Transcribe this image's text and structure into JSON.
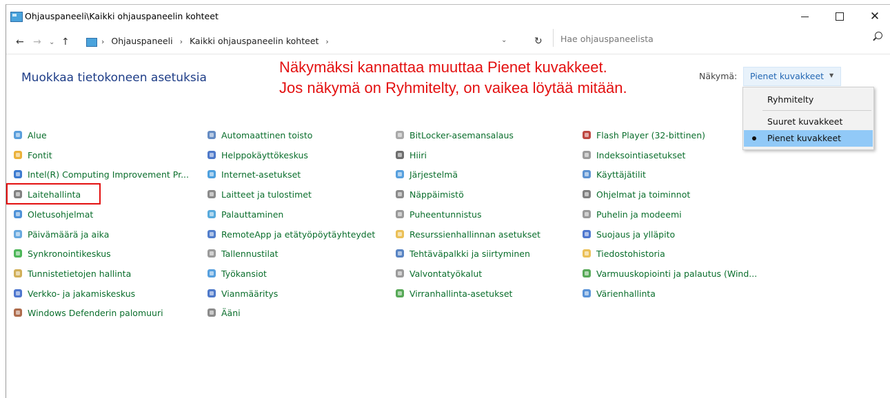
{
  "window": {
    "title": "Ohjauspaneeli\\Kaikki ohjauspaneelin kohteet",
    "minimize_icon": "minimize-icon",
    "maximize_icon": "maximize-icon",
    "close_glyph": "✕"
  },
  "address": {
    "crumbs": [
      "Ohjauspaneeli",
      "Kaikki ohjauspaneelin kohteet"
    ],
    "search_placeholder": "Hae ohjauspaneelista"
  },
  "header": {
    "title": "Muokkaa tietokoneen asetuksia",
    "annotation_line1": "Näkymäksi kannattaa muuttaa Pienet kuvakkeet.",
    "annotation_line2": "Jos näkymä on Ryhmitelty, on vaikea löytää mitään.",
    "view_label": "Näkymä:",
    "view_value": "Pienet kuvakkeet"
  },
  "view_menu": {
    "options": [
      "Ryhmitelty",
      "Suuret kuvakkeet",
      "Pienet kuvakkeet"
    ],
    "selected": "Pienet kuvakkeet"
  },
  "colors": {
    "link": "#0a6e2c",
    "title": "#1e3d87",
    "annotation": "#e31010",
    "menu_selected": "#91c9f7"
  },
  "columns": [
    [
      {
        "label": "Alue",
        "icon": "globe-clock-icon",
        "color": "#3c8dd6"
      },
      {
        "label": "Fontit",
        "icon": "font-icon",
        "color": "#e8a317"
      },
      {
        "label": "Intel(R) Computing Improvement Pr...",
        "icon": "intel-icon",
        "color": "#1a64c8"
      },
      {
        "label": "Laitehallinta",
        "icon": "device-manager-icon",
        "color": "#6b6b6b"
      },
      {
        "label": "Oletusohjelmat",
        "icon": "default-programs-icon",
        "color": "#2f7fd1"
      },
      {
        "label": "Päivämäärä ja aika",
        "icon": "calendar-clock-icon",
        "color": "#4d9ad9"
      },
      {
        "label": "Synkronointikeskus",
        "icon": "sync-icon",
        "color": "#2eaa3c"
      },
      {
        "label": "Tunnistetietojen hallinta",
        "icon": "credential-vault-icon",
        "color": "#c9a13b"
      },
      {
        "label": "Verkko- ja jakamiskeskus",
        "icon": "network-icon",
        "color": "#2f5fc7"
      },
      {
        "label": "Windows Defenderin palomuuri",
        "icon": "firewall-icon",
        "color": "#a0522d"
      }
    ],
    [
      {
        "label": "Automaattinen toisto",
        "icon": "autoplay-icon",
        "color": "#4a78b8"
      },
      {
        "label": "Helppokäyttökeskus",
        "icon": "ease-of-access-icon",
        "color": "#2f62c0"
      },
      {
        "label": "Internet-asetukset",
        "icon": "internet-options-icon",
        "color": "#2f8fd8"
      },
      {
        "label": "Laitteet ja tulostimet",
        "icon": "printer-icon",
        "color": "#777777"
      },
      {
        "label": "Palauttaminen",
        "icon": "recovery-icon",
        "color": "#3b9bd6"
      },
      {
        "label": "RemoteApp ja etätyöpöytäyhteydet",
        "icon": "remote-desktop-icon",
        "color": "#3467c2"
      },
      {
        "label": "Tallennustilat",
        "icon": "storage-spaces-icon",
        "color": "#8a8a8a"
      },
      {
        "label": "Työkansiot",
        "icon": "work-folders-icon",
        "color": "#3a8fd8"
      },
      {
        "label": "Vianmääritys",
        "icon": "troubleshooting-icon",
        "color": "#2f62c0"
      },
      {
        "label": "Ääni",
        "icon": "speaker-icon",
        "color": "#777777"
      }
    ],
    [
      {
        "label": "BitLocker-asemansalaus",
        "icon": "bitlocker-icon",
        "color": "#9a9a9a"
      },
      {
        "label": "Hiiri",
        "icon": "mouse-icon",
        "color": "#555555"
      },
      {
        "label": "Järjestelmä",
        "icon": "system-icon",
        "color": "#3a8fd8"
      },
      {
        "label": "Näppäimistö",
        "icon": "keyboard-icon",
        "color": "#777777"
      },
      {
        "label": "Puheentunnistus",
        "icon": "microphone-icon",
        "color": "#888888"
      },
      {
        "label": "Resurssienhallinnan asetukset",
        "icon": "folder-options-icon",
        "color": "#e8b53a"
      },
      {
        "label": "Tehtäväpalkki ja siirtyminen",
        "icon": "taskbar-icon",
        "color": "#3b6fb8"
      },
      {
        "label": "Valvontatyökalut",
        "icon": "admin-tools-icon",
        "color": "#8a8a8a"
      },
      {
        "label": "Virranhallinta-asetukset",
        "icon": "power-options-icon",
        "color": "#3a9a3a"
      }
    ],
    [
      {
        "label": "Flash Player (32-bittinen)",
        "icon": "flash-icon",
        "color": "#b3261e"
      },
      {
        "label": "Indeksointiasetukset",
        "icon": "indexing-icon",
        "color": "#8a8a8a"
      },
      {
        "label": "Käyttäjätilit",
        "icon": "user-accounts-icon",
        "color": "#3f7fc9"
      },
      {
        "label": "Ohjelmat ja toiminnot",
        "icon": "programs-features-icon",
        "color": "#6a6a6a"
      },
      {
        "label": "Puhelin ja modeemi",
        "icon": "phone-modem-icon",
        "color": "#888888"
      },
      {
        "label": "Suojaus ja ylläpito",
        "icon": "security-flag-icon",
        "color": "#2f5fc7"
      },
      {
        "label": "Tiedostohistoria",
        "icon": "file-history-icon",
        "color": "#e8b53a"
      },
      {
        "label": "Varmuuskopiointi ja palautus (Wind...",
        "icon": "backup-icon",
        "color": "#3a9a3a"
      },
      {
        "label": "Värienhallinta",
        "icon": "color-management-icon",
        "color": "#3b7fd0"
      }
    ]
  ]
}
